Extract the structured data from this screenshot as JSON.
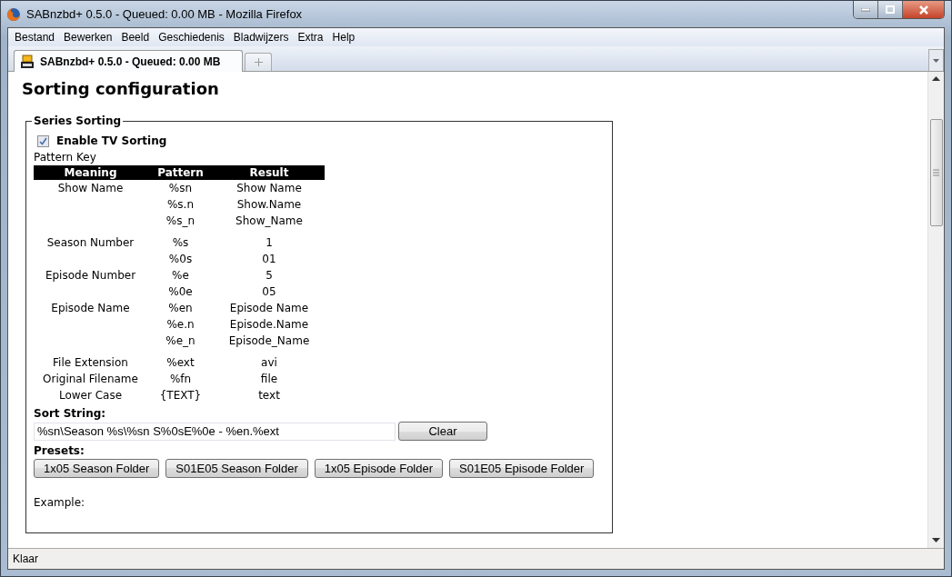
{
  "window": {
    "title": "SABnzbd+ 0.5.0 - Queued: 0.00 MB - Mozilla Firefox"
  },
  "menu": [
    "Bestand",
    "Bewerken",
    "Beeld",
    "Geschiedenis",
    "Bladwijzers",
    "Extra",
    "Help"
  ],
  "tabs": [
    {
      "label": "SABnzbd+ 0.5.0 - Queued: 0.00 MB",
      "selected": true
    }
  ],
  "page": {
    "heading": "Sorting configuration",
    "section": {
      "legend": "Series Sorting",
      "enable": {
        "label": "Enable TV Sorting",
        "checked": true
      },
      "pattern_key_label": "Pattern Key",
      "columns": [
        "Meaning",
        "Pattern",
        "Result"
      ],
      "sections": [
        {
          "items": [
            {
              "meaning": "Show Name",
              "patterns": [
                {
                  "pattern": "%sn",
                  "result": "Show Name"
                },
                {
                  "pattern": "%s.n",
                  "result": "Show.Name"
                },
                {
                  "pattern": "%s_n",
                  "result": "Show_Name"
                }
              ]
            }
          ]
        },
        {
          "items": [
            {
              "meaning": "Season Number",
              "patterns": [
                {
                  "pattern": "%s",
                  "result": "1"
                },
                {
                  "pattern": "%0s",
                  "result": "01"
                }
              ]
            },
            {
              "meaning": "Episode Number",
              "patterns": [
                {
                  "pattern": "%e",
                  "result": "5"
                },
                {
                  "pattern": "%0e",
                  "result": "05"
                }
              ]
            },
            {
              "meaning": "Episode Name",
              "patterns": [
                {
                  "pattern": "%en",
                  "result": "Episode Name"
                },
                {
                  "pattern": "%e.n",
                  "result": "Episode.Name"
                },
                {
                  "pattern": "%e_n",
                  "result": "Episode_Name"
                }
              ]
            }
          ]
        },
        {
          "items": [
            {
              "meaning": "File Extension",
              "patterns": [
                {
                  "pattern": "%ext",
                  "result": "avi"
                }
              ]
            },
            {
              "meaning": "Original Filename",
              "patterns": [
                {
                  "pattern": "%fn",
                  "result": "file"
                }
              ]
            },
            {
              "meaning": "Lower Case",
              "patterns": [
                {
                  "pattern": "{TEXT}",
                  "result": "text"
                }
              ]
            }
          ]
        }
      ],
      "sort_string": {
        "label": "Sort String:",
        "value": "%sn\\Season %s\\%sn S%0sE%0e - %en.%ext",
        "clear_button": "Clear"
      },
      "presets": {
        "label": "Presets:",
        "buttons": [
          "1x05 Season Folder",
          "S01E05 Season Folder",
          "1x05 Episode Folder",
          "S01E05 Episode Folder"
        ]
      },
      "example_label": "Example:"
    }
  },
  "status_bar": {
    "text": "Klaar"
  }
}
